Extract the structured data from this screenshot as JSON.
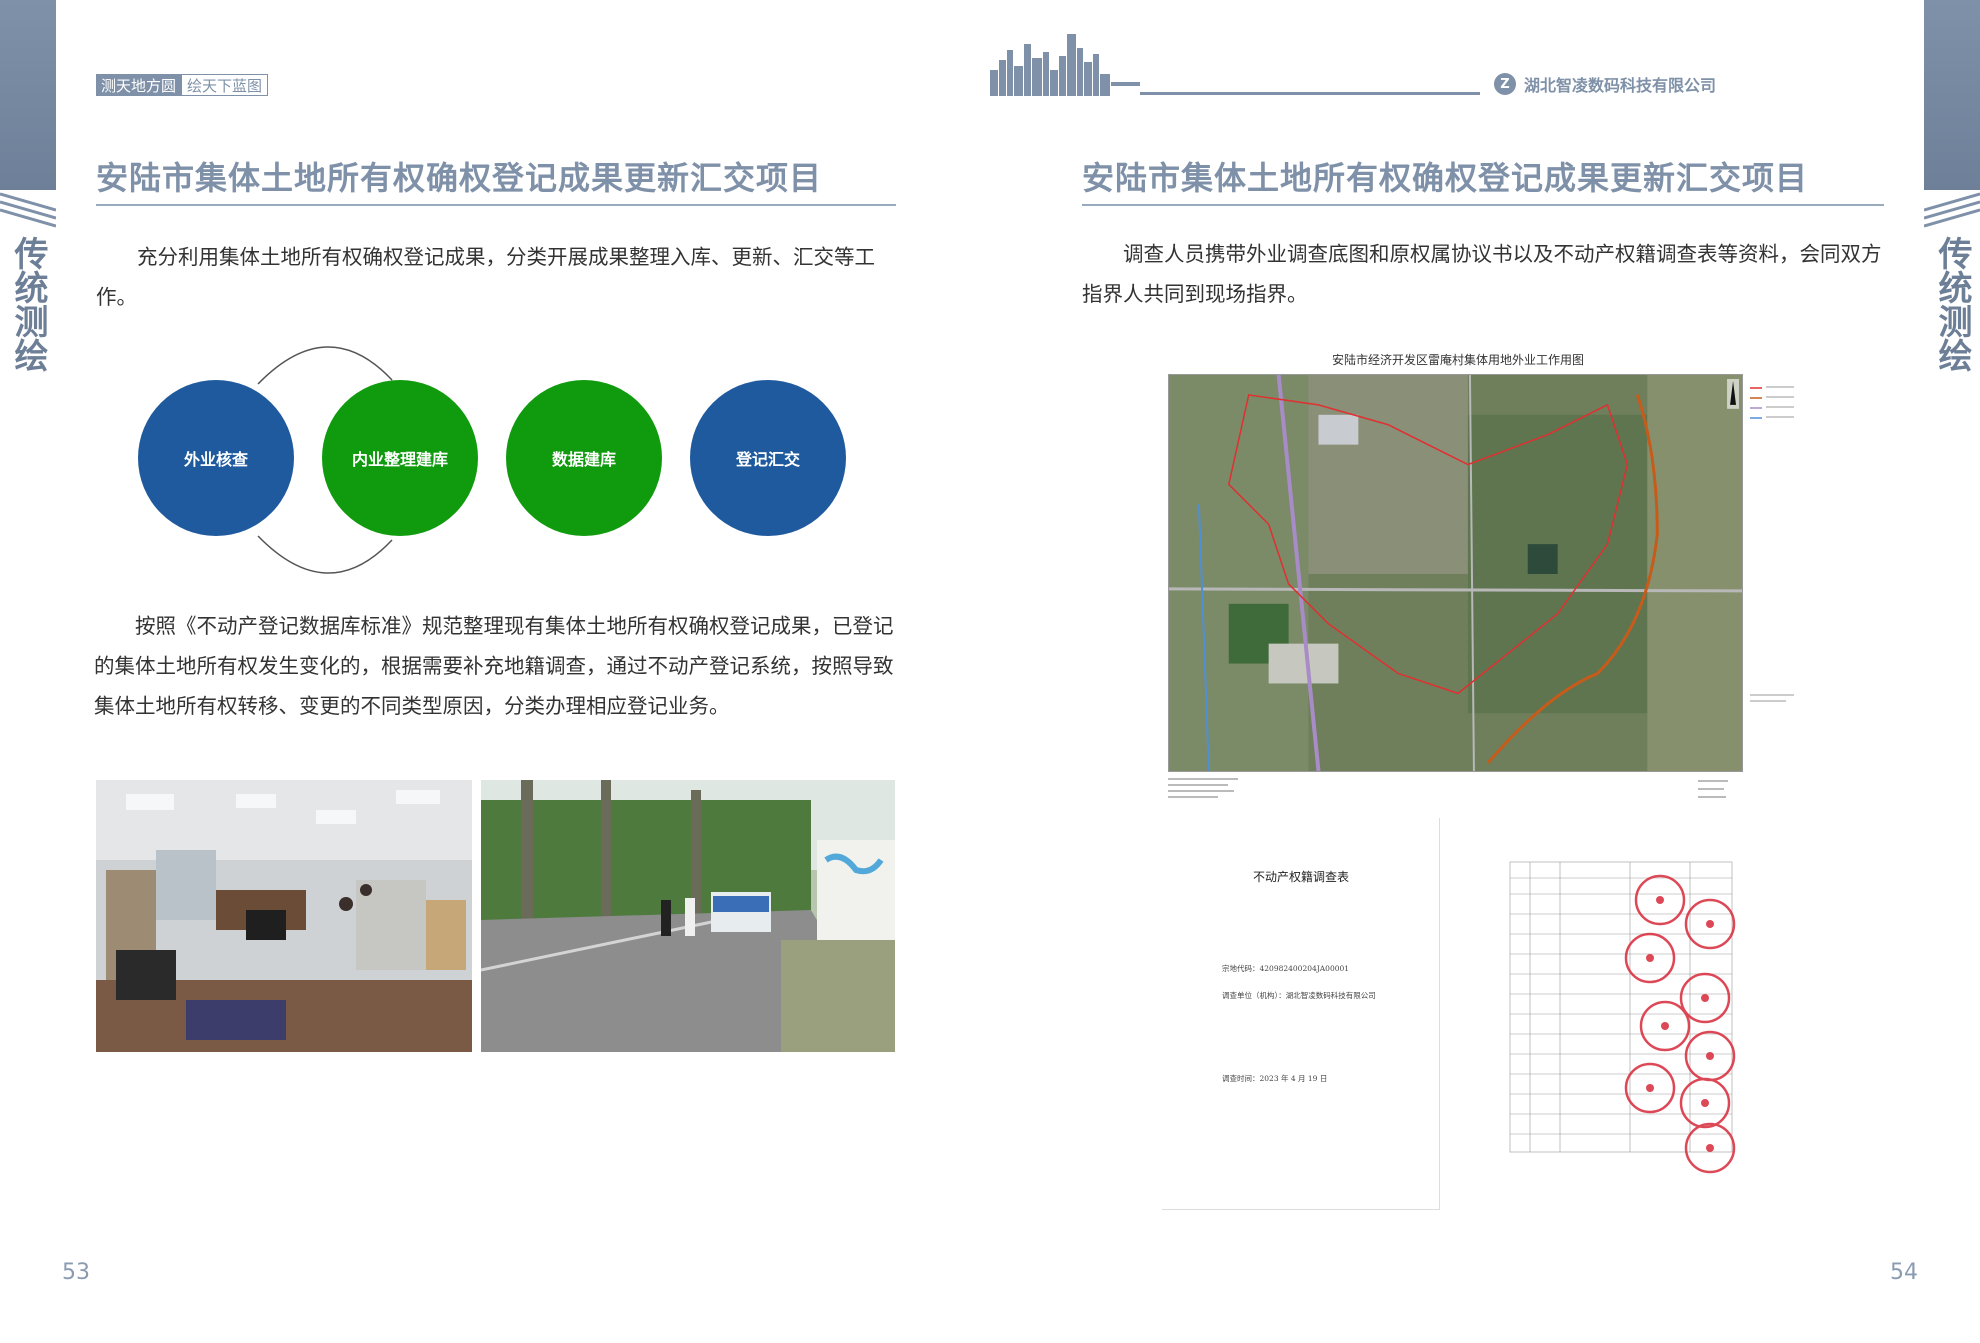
{
  "side_label": "传统测绘",
  "slogan": {
    "part1": "测天地方圆",
    "part2": "绘天下蓝图"
  },
  "company": {
    "logo": "Z",
    "name": "湖北智凌数码科技有限公司"
  },
  "left_page": {
    "title": "安陆市集体土地所有权确权登记成果更新汇交项目",
    "para1": "充分利用集体土地所有权确权登记成果，分类开展成果整理入库、更新、汇交等工作。",
    "steps": [
      "外业核查",
      "内业整理建库",
      "数据建库",
      "登记汇交"
    ],
    "para2": "按照《不动产登记数据库标准》规范整理现有集体土地所有权确权登记成果，已登记的集体土地所有权发生变化的，根据需要补充地籍调查，通过不动产登记系统，按照导致集体土地所有权转移、变更的不同类型原因，分类办理相应登记业务。",
    "page_number": "53"
  },
  "right_page": {
    "title": "安陆市集体土地所有权确权登记成果更新汇交项目",
    "para": "调查人员携带外业调查底图和原权属协议书以及不动产权籍调查表等资料，会同双方指界人共同到现场指界。",
    "map_caption": "安陆市经济开发区雷庵村集体用地外业工作用图",
    "doc": {
      "title": "不动产权籍调查表",
      "code": "宗地代码：420982400204JA00001",
      "unit": "调查单位（机构）：湖北智凌数码科技有限公司",
      "date": "调查时间：2023 年 4 月 19 日"
    },
    "page_number": "54"
  },
  "colors": {
    "accent": "#7f91a8",
    "blue": "#1f5a9e",
    "green": "#109a0e"
  }
}
